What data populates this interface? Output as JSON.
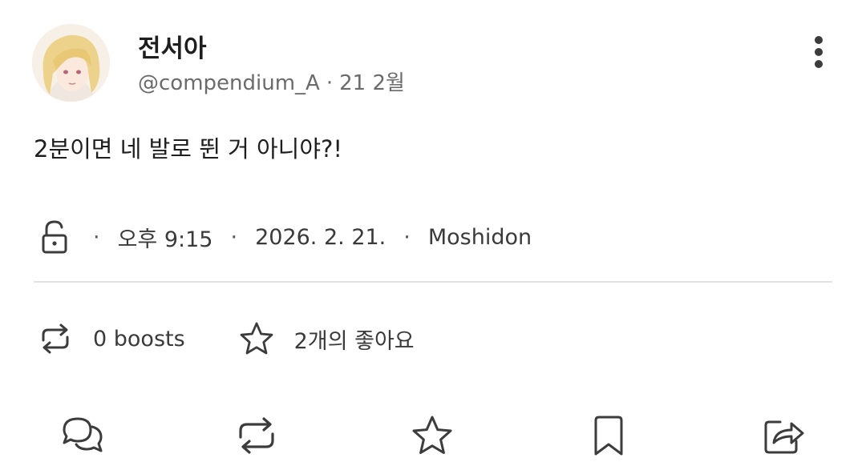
{
  "post": {
    "author": {
      "display_name": "전서아",
      "handle": "@compendium_A",
      "separator": "·",
      "relative_date": "21 2월"
    },
    "text": "2분이면 네 발로 뛴 거 아니야?!",
    "meta": {
      "visibility_icon": "unlock-icon",
      "separator": "·",
      "time": "오후 9:15",
      "date": "2026. 2. 21.",
      "client": "Moshidon"
    },
    "stats": {
      "boosts_label": "0 boosts",
      "favorites_label": "2개의 좋아요"
    },
    "actions": [
      "reply-icon",
      "boost-icon",
      "favorite-icon",
      "bookmark-icon",
      "share-icon"
    ]
  },
  "colors": {
    "text": "#1e1e1e",
    "secondary": "#6b6b6b",
    "icon": "#3c3c3c",
    "divider": "#e2e2e2"
  }
}
